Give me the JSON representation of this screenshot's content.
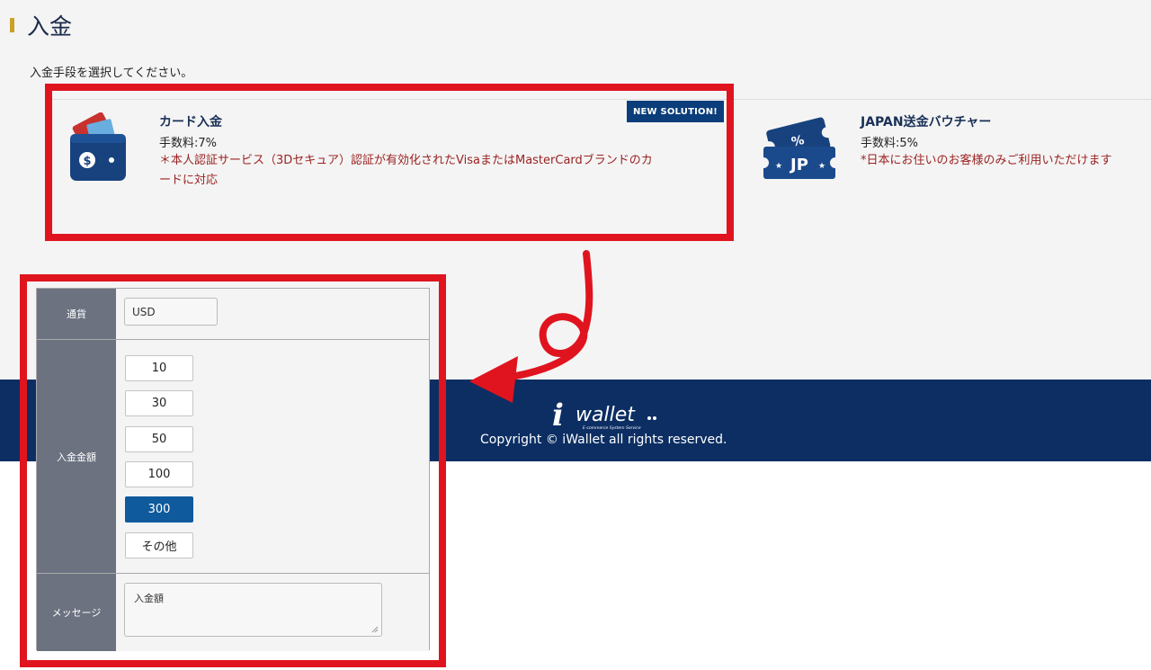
{
  "page": {
    "title": "入金",
    "instruction": "入金手段を選択してください。"
  },
  "methods": {
    "card": {
      "name": "カード入金",
      "fee": "手数料:7%",
      "note_line1": "＊本人認証サービス（3Dセキュア）認証が有効化されたVisaまたはMasterCardブランドのカ",
      "note_line2": "ードに対応",
      "badge": "NEW SOLUTION!",
      "icon": "wallet-dollar-icon"
    },
    "voucher": {
      "name": "JAPAN送金バウチャー",
      "fee": "手数料:5%",
      "note": "*日本にお住いのお客様のみご利用いただけます",
      "icon": "jp-voucher-ticket-icon",
      "icon_text_top": "%",
      "icon_text_main": "JP"
    }
  },
  "form": {
    "currency_label": "通貨",
    "currency_value": "USD",
    "amount_label": "入金金額",
    "amounts": [
      "10",
      "30",
      "50",
      "100",
      "300",
      "その他"
    ],
    "selected_amount": "300",
    "message_label": "メッセージ",
    "message_value": "入金額"
  },
  "footer": {
    "logo_text": "wallet",
    "logo_sub": "E-commerce System Service",
    "copyright": "Copyright © iWallet all rights reserved."
  },
  "colors": {
    "footer_bg": "#0c2e63",
    "highlight": "#e0141e",
    "selected_button": "#0e5a9c",
    "note_text": "#9b2222",
    "title_mark": "#c9a227"
  }
}
